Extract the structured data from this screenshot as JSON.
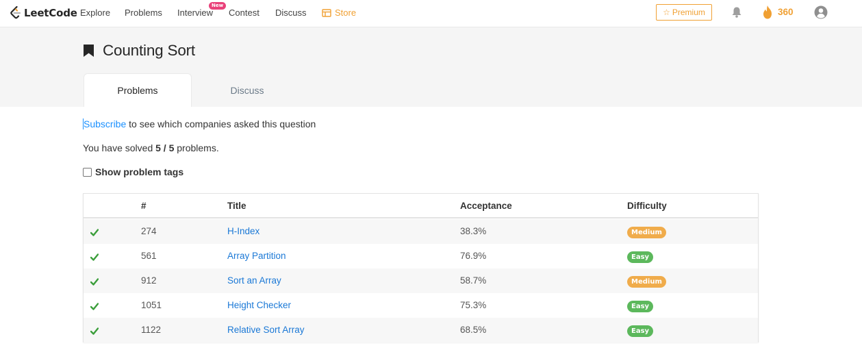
{
  "nav": {
    "logo_text": "LeetCode",
    "items": [
      "Explore",
      "Problems",
      "Interview",
      "Contest",
      "Discuss"
    ],
    "new_badge": "New",
    "store": "Store",
    "premium": "Premium",
    "streak": "360",
    "accent": "#f0a033"
  },
  "page": {
    "title": "Counting Sort",
    "tabs": [
      "Problems",
      "Discuss"
    ],
    "subscribe_link": "Subscribe",
    "subscribe_rest": " to see which companies asked this question",
    "solved_prefix": "You have solved ",
    "solved_count": "5 / 5",
    "solved_suffix": " problems.",
    "show_tags_label": "Show problem tags"
  },
  "table": {
    "headers": [
      "#",
      "Title",
      "Acceptance",
      "Difficulty"
    ],
    "rows": [
      {
        "solved": true,
        "num": "274",
        "title": "H-Index",
        "acceptance": "38.3%",
        "difficulty": "Medium",
        "color": "#f0ac4b"
      },
      {
        "solved": true,
        "num": "561",
        "title": "Array Partition",
        "acceptance": "76.9%",
        "difficulty": "Easy",
        "color": "#5cb85c"
      },
      {
        "solved": true,
        "num": "912",
        "title": "Sort an Array",
        "acceptance": "58.7%",
        "difficulty": "Medium",
        "color": "#f0ac4b"
      },
      {
        "solved": true,
        "num": "1051",
        "title": "Height Checker",
        "acceptance": "75.3%",
        "difficulty": "Easy",
        "color": "#5cb85c"
      },
      {
        "solved": true,
        "num": "1122",
        "title": "Relative Sort Array",
        "acceptance": "68.5%",
        "difficulty": "Easy",
        "color": "#5cb85c"
      }
    ]
  }
}
